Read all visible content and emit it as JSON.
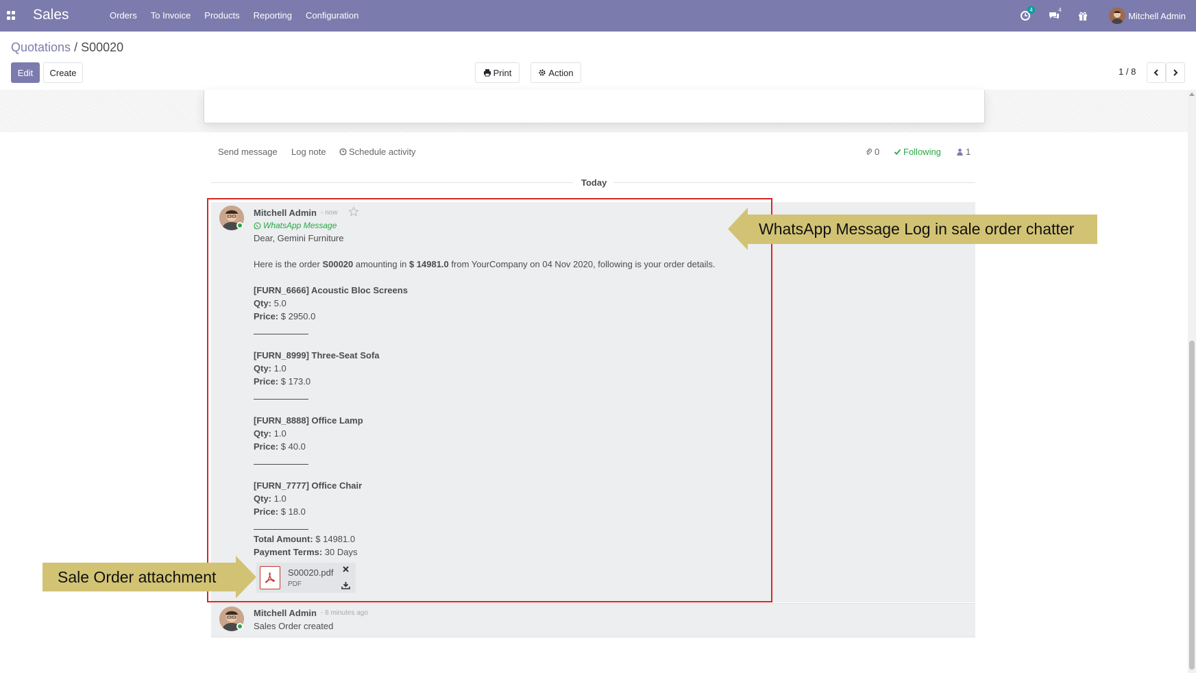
{
  "navbar": {
    "brand": "Sales",
    "menu": [
      "Orders",
      "To Invoice",
      "Products",
      "Reporting",
      "Configuration"
    ],
    "activity_badge": "4",
    "messages_badge": "4",
    "user_name": "Mitchell Admin",
    "icons": [
      "apps-icon",
      "activity-clock-icon",
      "chat-bubbles-icon",
      "gift-icon"
    ]
  },
  "control_panel": {
    "breadcrumb_parent": "Quotations",
    "breadcrumb_sep": "/",
    "breadcrumb_current": "S00020",
    "edit_label": "Edit",
    "create_label": "Create",
    "print_label": "Print",
    "action_label": "Action",
    "pager": "1 / 8"
  },
  "chatter": {
    "send_message": "Send message",
    "log_note": "Log note",
    "schedule_activity": "Schedule activity",
    "attachments_count": "0",
    "following": "Following",
    "followers_count": "1",
    "date_separator": "Today"
  },
  "message1": {
    "author": "Mitchell Admin",
    "time": "- now",
    "channel": "WhatsApp Message",
    "greeting": "Dear, Gemini Furniture",
    "intro_1": "Here is the order ",
    "order_ref": "S00020",
    "intro_2": " amounting in ",
    "amount": "$ 14981.0",
    "intro_3": " from YourCompany on 04 Nov 2020, following is your order details.",
    "qty_label": "Qty:",
    "price_label": "Price:",
    "items": [
      {
        "name": "[FURN_6666] Acoustic Bloc Screens",
        "qty": " 5.0",
        "price": " $ 2950.0"
      },
      {
        "name": "[FURN_8999] Three-Seat Sofa",
        "qty": " 1.0",
        "price": " $ 173.0"
      },
      {
        "name": "[FURN_8888] Office Lamp",
        "qty": " 1.0",
        "price": " $ 40.0"
      },
      {
        "name": "[FURN_7777] Office Chair",
        "qty": " 1.0",
        "price": " $ 18.0"
      }
    ],
    "total_label": "Total Amount:",
    "total_value": " $ 14981.0",
    "terms_label": "Payment Terms:",
    "terms_value": " 30 Days",
    "attachment_name": "S00020.pdf",
    "attachment_ext": "PDF"
  },
  "message2": {
    "author": "Mitchell Admin",
    "time": "- 8 minutes ago",
    "body": "Sales Order created"
  },
  "annotations": {
    "whatsapp_log": "WhatsApp Message Log in sale order chatter",
    "attachment": "Sale Order attachment"
  },
  "colors": {
    "brand": "#7c7bad",
    "callout": "#d2c374",
    "highlight_frame": "#d92525",
    "following": "#28a745"
  }
}
